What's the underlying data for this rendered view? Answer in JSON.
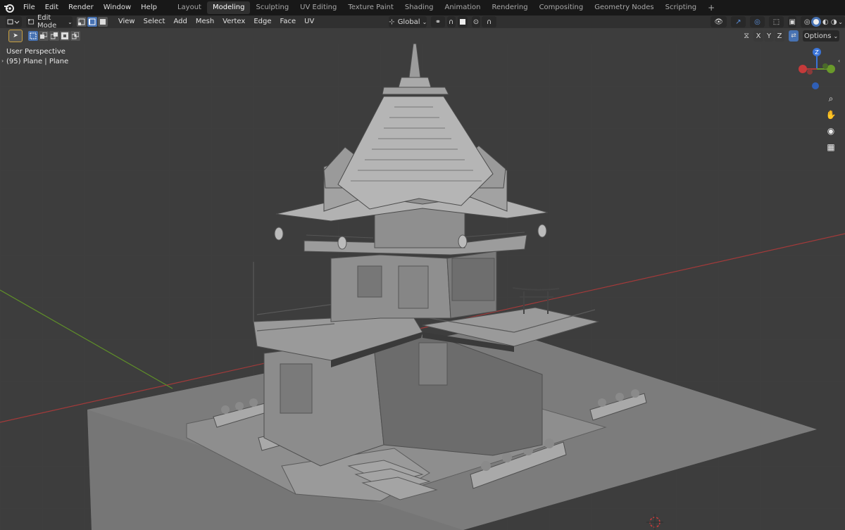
{
  "menu": {
    "items": [
      "File",
      "Edit",
      "Render",
      "Window",
      "Help"
    ]
  },
  "workspaces": [
    "Layout",
    "Modeling",
    "Sculpting",
    "UV Editing",
    "Texture Paint",
    "Shading",
    "Animation",
    "Rendering",
    "Compositing",
    "Geometry Nodes",
    "Scripting"
  ],
  "workspace_add": "+",
  "header": {
    "mode": "Edit Mode",
    "menus": [
      "View",
      "Select",
      "Add",
      "Mesh",
      "Vertex",
      "Edge",
      "Face",
      "UV"
    ],
    "orientation": "Global",
    "options": "Options",
    "axes": [
      "X",
      "Y",
      "Z"
    ]
  },
  "viewport": {
    "view_name": "User Perspective",
    "object_info": "(95) Plane | Plane"
  },
  "gizmo": {
    "z_label": "Z"
  },
  "colors": {
    "accent": "#4772b3",
    "x_axis": "#b03a3a",
    "y_axis": "#6a9a2a",
    "z_axis": "#2f6fd6",
    "background": "#3d3d3d",
    "menubar": "#181818"
  }
}
